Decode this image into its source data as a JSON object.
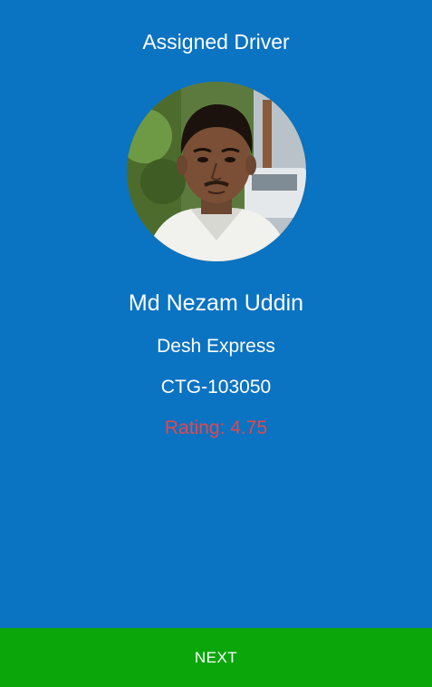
{
  "header": {
    "title": "Assigned Driver"
  },
  "driver": {
    "name": "Md Nezam Uddin",
    "company": "Desh Express",
    "vehicle_number": "CTG-103050",
    "rating_text": "Rating: 4.75",
    "photo_icon": "driver-photo"
  },
  "footer": {
    "next_label": "NEXT"
  },
  "colors": {
    "background": "#0a73c2",
    "rating": "#e8454a",
    "next_button": "#0aa60a",
    "text": "#ffffff"
  }
}
